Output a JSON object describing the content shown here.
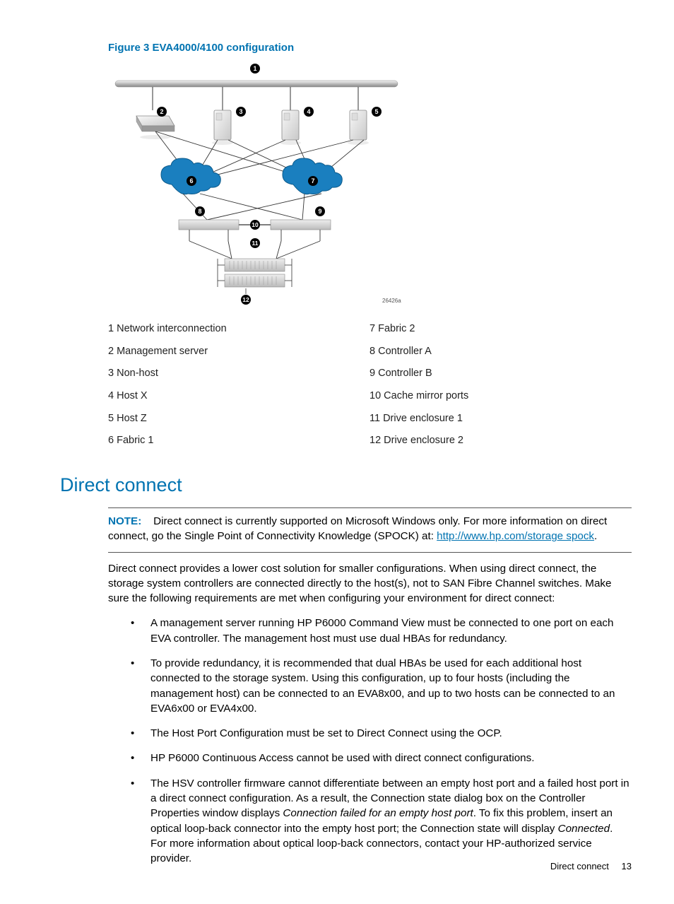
{
  "figure": {
    "caption": "Figure 3 EVA4000/4100 configuration",
    "refnum": "26426a",
    "callouts": [
      "1",
      "2",
      "3",
      "4",
      "5",
      "6",
      "7",
      "8",
      "9",
      "10",
      "11",
      "12"
    ]
  },
  "legend_left": [
    "1 Network interconnection",
    "2 Management server",
    "3 Non-host",
    "4 Host X",
    "5 Host Z",
    "6 Fabric 1"
  ],
  "legend_right": [
    "7 Fabric 2",
    "8 Controller A",
    "9 Controller B",
    "10 Cache mirror ports",
    "11 Drive enclosure 1",
    "12 Drive enclosure 2"
  ],
  "section": {
    "heading": "Direct connect"
  },
  "note": {
    "label": "NOTE:",
    "pre": "Direct connect is currently supported on Microsoft Windows only. For more information on direct connect, go the Single Point of Connectivity Knowledge (SPOCK) at: ",
    "link": "http://www.hp.com/storage spock",
    "post": "."
  },
  "intro": "Direct connect provides a lower cost solution for smaller configurations. When using direct connect, the storage system controllers are connected directly to the host(s), not to SAN Fibre Channel switches. Make sure the following requirements are met when configuring your environment for direct connect:",
  "bullets": {
    "b1": "A management server running HP P6000 Command View must be connected to one port on each EVA controller. The management host must use dual HBAs for redundancy.",
    "b2": "To provide redundancy, it is recommended that dual HBAs be used for each additional host connected to the storage system. Using this configuration, up to four hosts (including the management host) can be connected to an EVA8x00, and up to two hosts can be connected to an EVA6x00 or EVA4x00.",
    "b3": "The Host Port Configuration must be set to Direct Connect using the OCP.",
    "b4": "HP P6000 Continuous Access cannot be used with direct connect configurations.",
    "b5a": "The HSV controller firmware cannot differentiate between an empty host port and a failed host port in a direct connect configuration. As a result, the Connection state dialog box on the Controller Properties window displays ",
    "b5i1": "Connection failed for an empty host port",
    "b5b": ". To fix this problem, insert an optical loop-back connector into the empty host port; the Connection state will display ",
    "b5i2": "Connected",
    "b5c": ". For more information about optical loop-back connectors, contact your HP-authorized service provider."
  },
  "footer": {
    "title": "Direct connect",
    "page": "13"
  }
}
